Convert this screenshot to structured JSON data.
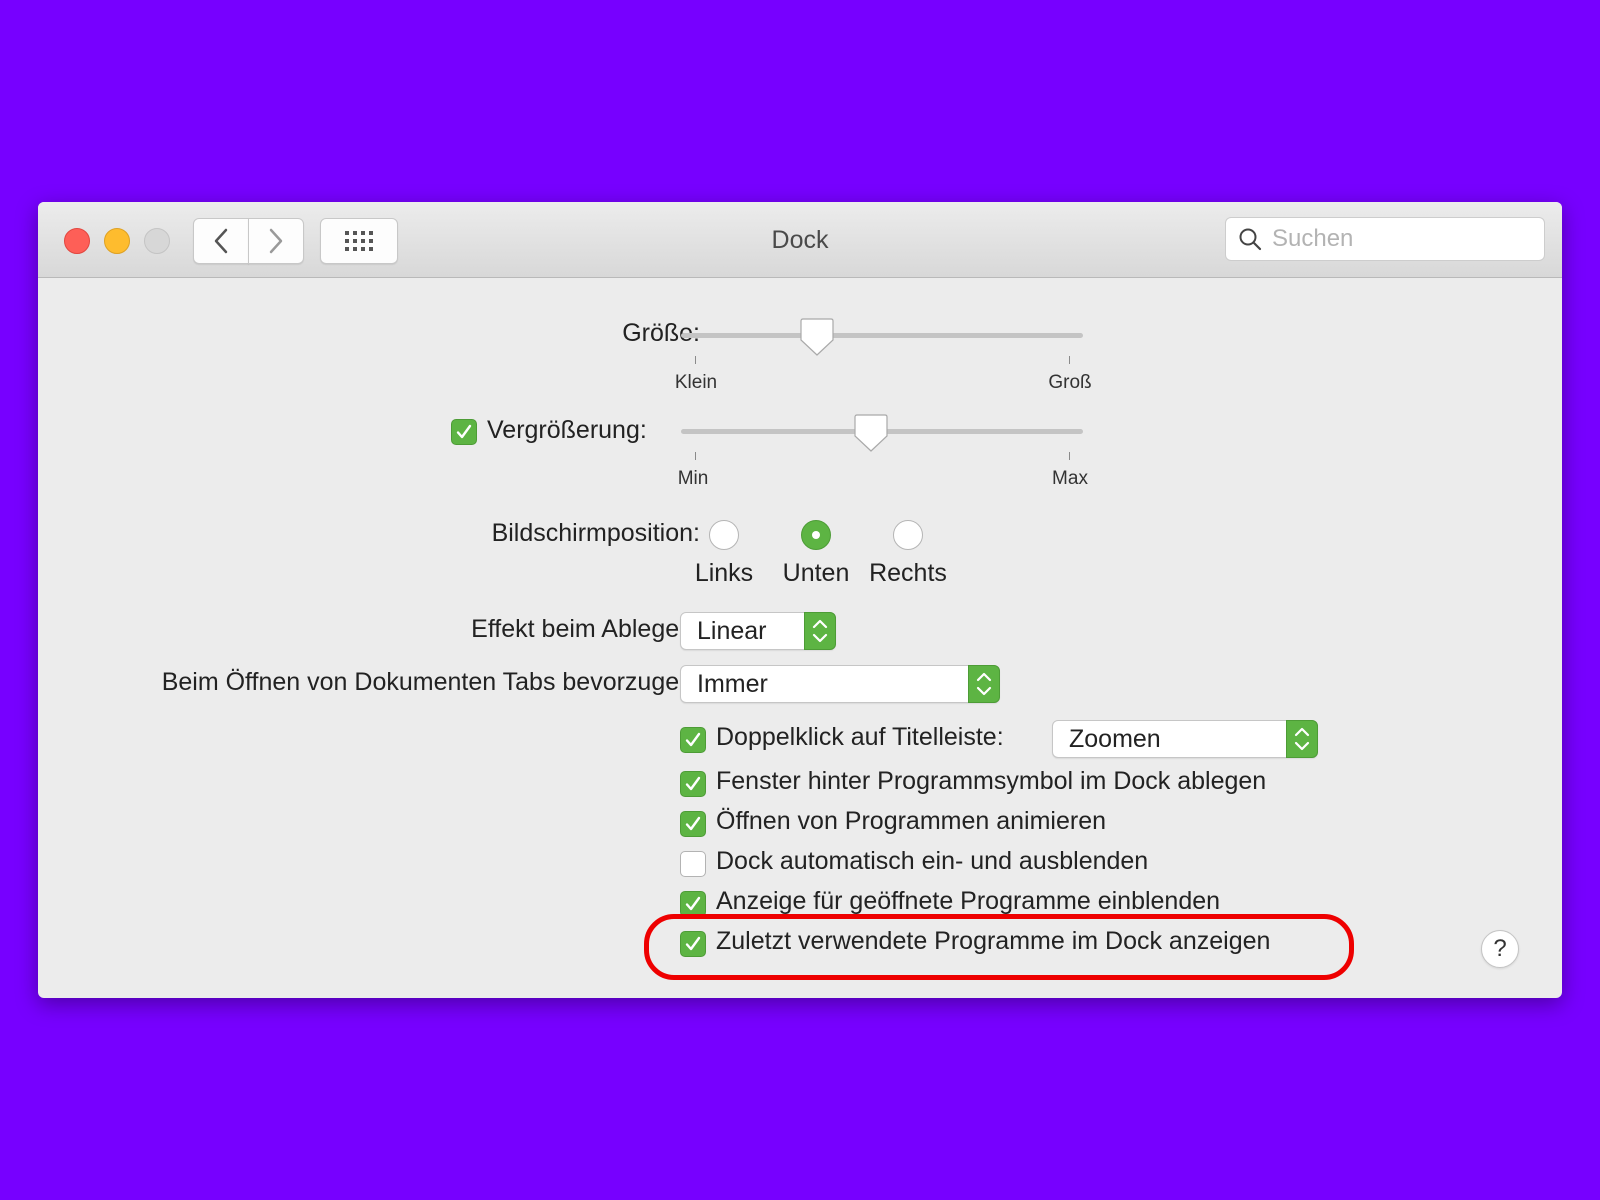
{
  "window": {
    "title": "Dock",
    "search": {
      "placeholder": "Suchen",
      "value": ""
    }
  },
  "size": {
    "label": "Größe:",
    "min_label": "Klein",
    "max_label": "Groß",
    "value_fraction": 0.33
  },
  "magnification": {
    "enabled": true,
    "label": "Vergrößerung:",
    "min_label": "Min",
    "max_label": "Max",
    "value_fraction": 0.47
  },
  "position": {
    "label": "Bildschirmposition:",
    "options": [
      "Links",
      "Unten",
      "Rechts"
    ],
    "selected": "Unten"
  },
  "minimize_effect": {
    "label": "Effekt beim Ablegen:",
    "value": "Linear"
  },
  "prefer_tabs": {
    "label": "Beim Öffnen von Dokumenten Tabs bevorzugen:",
    "value": "Immer"
  },
  "options": [
    {
      "label": "Doppelklick auf Titelleiste:",
      "checked": true,
      "popup_value": "Zoomen"
    },
    {
      "label": "Fenster hinter Programmsymbol im Dock ablegen",
      "checked": true
    },
    {
      "label": "Öffnen von Programmen animieren",
      "checked": true
    },
    {
      "label": "Dock automatisch ein- und ausblenden",
      "checked": false
    },
    {
      "label": "Anzeige für geöffnete Programme einblenden",
      "checked": true
    },
    {
      "label": "Zuletzt verwendete Programme im Dock anzeigen",
      "checked": true
    }
  ],
  "help": {
    "label": "?"
  },
  "colors": {
    "background": "#7700ff",
    "accent": "#5db443",
    "highlight": "#ee0000"
  }
}
